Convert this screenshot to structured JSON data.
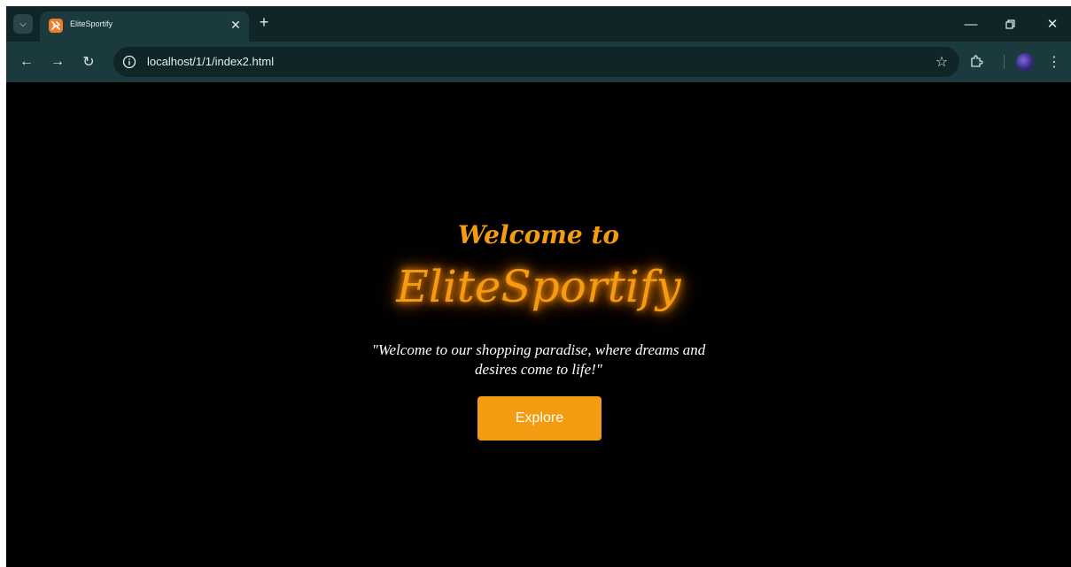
{
  "browser": {
    "tab_title": "EliteSportify",
    "url": "localhost/1/1/index2.html",
    "icons": {
      "tab_search": "chevron-down-icon",
      "favicon": "xampp-icon",
      "tab_close": "close-icon",
      "new_tab": "plus-icon",
      "minimize": "minimize-icon",
      "restore": "restore-icon",
      "close_window": "close-icon",
      "back": "arrow-left-icon",
      "forward": "arrow-right-icon",
      "reload": "reload-icon",
      "site_info": "info-icon",
      "bookmark": "star-icon",
      "extensions": "puzzle-icon",
      "profile": "avatar",
      "menu": "kebab-menu-icon"
    },
    "colors": {
      "tabstrip": "#0f2528",
      "toolbar": "#1a3a3e",
      "omnibox": "#0f2528",
      "favicon": "#f07c28"
    }
  },
  "page": {
    "welcome": "Welcome to",
    "brand": "EliteSportify",
    "tagline": "\"Welcome to our shopping paradise, where dreams and desires come to life!\"",
    "explore_button": "Explore",
    "colors": {
      "background": "#000000",
      "accent": "#f39c12",
      "glow": "#ff8c00",
      "text": "#ffffff"
    }
  }
}
